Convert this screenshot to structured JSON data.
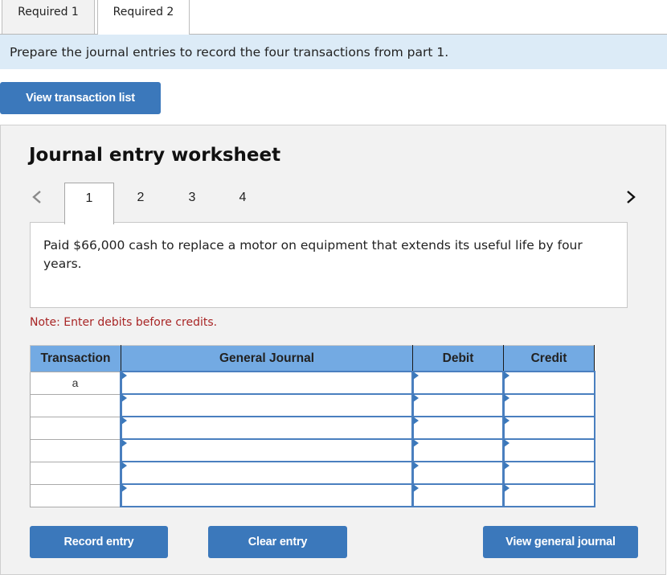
{
  "tabs": [
    {
      "label": "Required 1",
      "active": false
    },
    {
      "label": "Required 2",
      "active": true
    }
  ],
  "instruction": "Prepare the journal entries to record the four transactions from part 1.",
  "buttons": {
    "view_transaction_list": "View transaction list",
    "record_entry": "Record entry",
    "clear_entry": "Clear entry",
    "view_general_journal": "View general journal"
  },
  "worksheet": {
    "title": "Journal entry worksheet",
    "entry_tabs": [
      "1",
      "2",
      "3",
      "4"
    ],
    "active_entry": "1",
    "prev_icon": "chevron-left",
    "next_icon": "chevron-right",
    "description": "Paid $66,000 cash to replace a motor on equipment that extends its useful life by four years.",
    "note": "Note: Enter debits before credits."
  },
  "journal": {
    "headers": [
      "Transaction",
      "General Journal",
      "Debit",
      "Credit"
    ],
    "rows": [
      {
        "transaction": "a",
        "account": "",
        "debit": "",
        "credit": ""
      },
      {
        "transaction": "",
        "account": "",
        "debit": "",
        "credit": ""
      },
      {
        "transaction": "",
        "account": "",
        "debit": "",
        "credit": ""
      },
      {
        "transaction": "",
        "account": "",
        "debit": "",
        "credit": ""
      },
      {
        "transaction": "",
        "account": "",
        "debit": "",
        "credit": ""
      },
      {
        "transaction": "",
        "account": "",
        "debit": "",
        "credit": ""
      }
    ]
  },
  "colors": {
    "button_blue": "#3b78bb",
    "header_blue": "#73aae3",
    "instruction_bg": "#dcebf7",
    "note_red": "#a82525"
  }
}
